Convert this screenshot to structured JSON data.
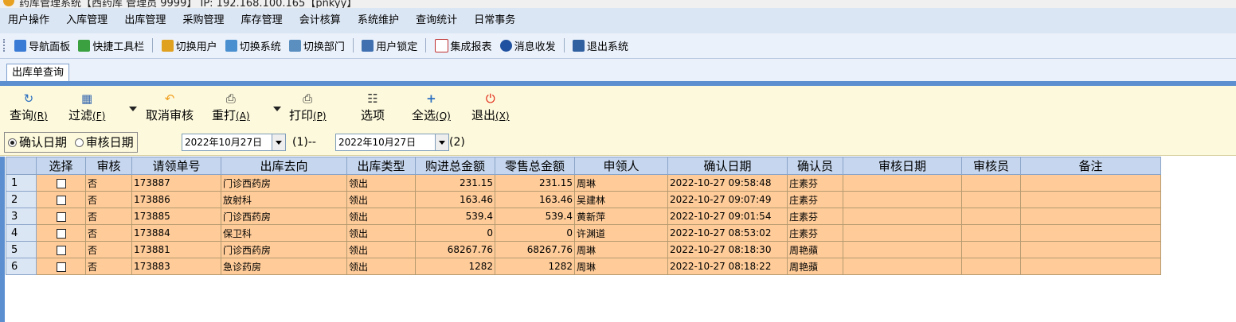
{
  "window_title": "药库管理系统【西药库 管理员 9999】  IP: 192.168.100.165【pnkyy】",
  "menu": [
    "用户操作",
    "入库管理",
    "出库管理",
    "采购管理",
    "库存管理",
    "会计核算",
    "系统维护",
    "查询统计",
    "日常事务"
  ],
  "quick_toolbar": [
    {
      "label": "导航面板",
      "icon": "navigation-panel-icon",
      "color": "#3a7bd5"
    },
    {
      "label": "快捷工具栏",
      "icon": "quick-toolbar-icon",
      "color": "#3aa040"
    },
    {
      "label": "切换用户",
      "icon": "switch-user-icon",
      "color": "#e0a020"
    },
    {
      "label": "切换系统",
      "icon": "switch-system-icon",
      "color": "#4a90d0"
    },
    {
      "label": "切换部门",
      "icon": "switch-department-icon",
      "color": "#5a8fc0"
    },
    {
      "label": "用户锁定",
      "icon": "user-lock-icon",
      "color": "#4070b0"
    },
    {
      "label": "集成报表",
      "icon": "integrated-report-icon",
      "color": "#c03030"
    },
    {
      "label": "消息收发",
      "icon": "message-icon",
      "color": "#2050a0"
    },
    {
      "label": "退出系统",
      "icon": "exit-system-icon",
      "color": "#3060a0"
    }
  ],
  "tab": {
    "label": "出库单查询"
  },
  "actions": {
    "query": {
      "label": "查询",
      "key": "(R)"
    },
    "filter": {
      "label": "过滤",
      "key": "(F)"
    },
    "cancel_audit": {
      "label": "取消审核"
    },
    "reprint": {
      "label": "重打",
      "key": "(A)"
    },
    "print": {
      "label": "打印",
      "key": "(P)"
    },
    "options": {
      "label": "选项"
    },
    "select_all": {
      "label": "全选",
      "key": "(Q)"
    },
    "exit": {
      "label": "退出",
      "key": "(X)"
    }
  },
  "date_filter": {
    "radio_confirm": "确认日期",
    "radio_audit": "审核日期",
    "selected": "确认日期",
    "start_date": "2022年10月27日",
    "start_suffix": "(1)--",
    "end_date": "2022年10月27日",
    "end_suffix": "(2)"
  },
  "table": {
    "columns": [
      "选择",
      "审核",
      "请领单号",
      "出库去向",
      "出库类型",
      "购进总金额",
      "零售总金额",
      "申领人",
      "确认日期",
      "确认员",
      "审核日期",
      "审核员",
      "备注"
    ],
    "rows": [
      {
        "n": "1",
        "audit": "否",
        "no": "173887",
        "dest": "门诊西药房",
        "type": "领出",
        "buy": "231.15",
        "retail": "231.15",
        "applicant": "周琳",
        "confirm_date": "2022-10-27 09:58:48",
        "confirmer": "庄素芬",
        "audit_date": "",
        "auditor": "",
        "note": ""
      },
      {
        "n": "2",
        "audit": "否",
        "no": "173886",
        "dest": "放射科",
        "type": "领出",
        "buy": "163.46",
        "retail": "163.46",
        "applicant": "吴建林",
        "confirm_date": "2022-10-27 09:07:49",
        "confirmer": "庄素芬",
        "audit_date": "",
        "auditor": "",
        "note": ""
      },
      {
        "n": "3",
        "audit": "否",
        "no": "173885",
        "dest": "门诊西药房",
        "type": "领出",
        "buy": "539.4",
        "retail": "539.4",
        "applicant": "黄新萍",
        "confirm_date": "2022-10-27 09:01:54",
        "confirmer": "庄素芬",
        "audit_date": "",
        "auditor": "",
        "note": ""
      },
      {
        "n": "4",
        "audit": "否",
        "no": "173884",
        "dest": "保卫科",
        "type": "领出",
        "buy": "0",
        "retail": "0",
        "applicant": "许渊道",
        "confirm_date": "2022-10-27 08:53:02",
        "confirmer": "庄素芬",
        "audit_date": "",
        "auditor": "",
        "note": ""
      },
      {
        "n": "5",
        "audit": "否",
        "no": "173881",
        "dest": "门诊西药房",
        "type": "领出",
        "buy": "68267.76",
        "retail": "68267.76",
        "applicant": "周琳",
        "confirm_date": "2022-10-27 08:18:30",
        "confirmer": "周艳蘋",
        "audit_date": "",
        "auditor": "",
        "note": ""
      },
      {
        "n": "6",
        "audit": "否",
        "no": "173883",
        "dest": "急诊药房",
        "type": "领出",
        "buy": "1282",
        "retail": "1282",
        "applicant": "周琳",
        "confirm_date": "2022-10-27 08:18:22",
        "confirmer": "周艳蘋",
        "audit_date": "",
        "auditor": "",
        "note": ""
      }
    ]
  }
}
